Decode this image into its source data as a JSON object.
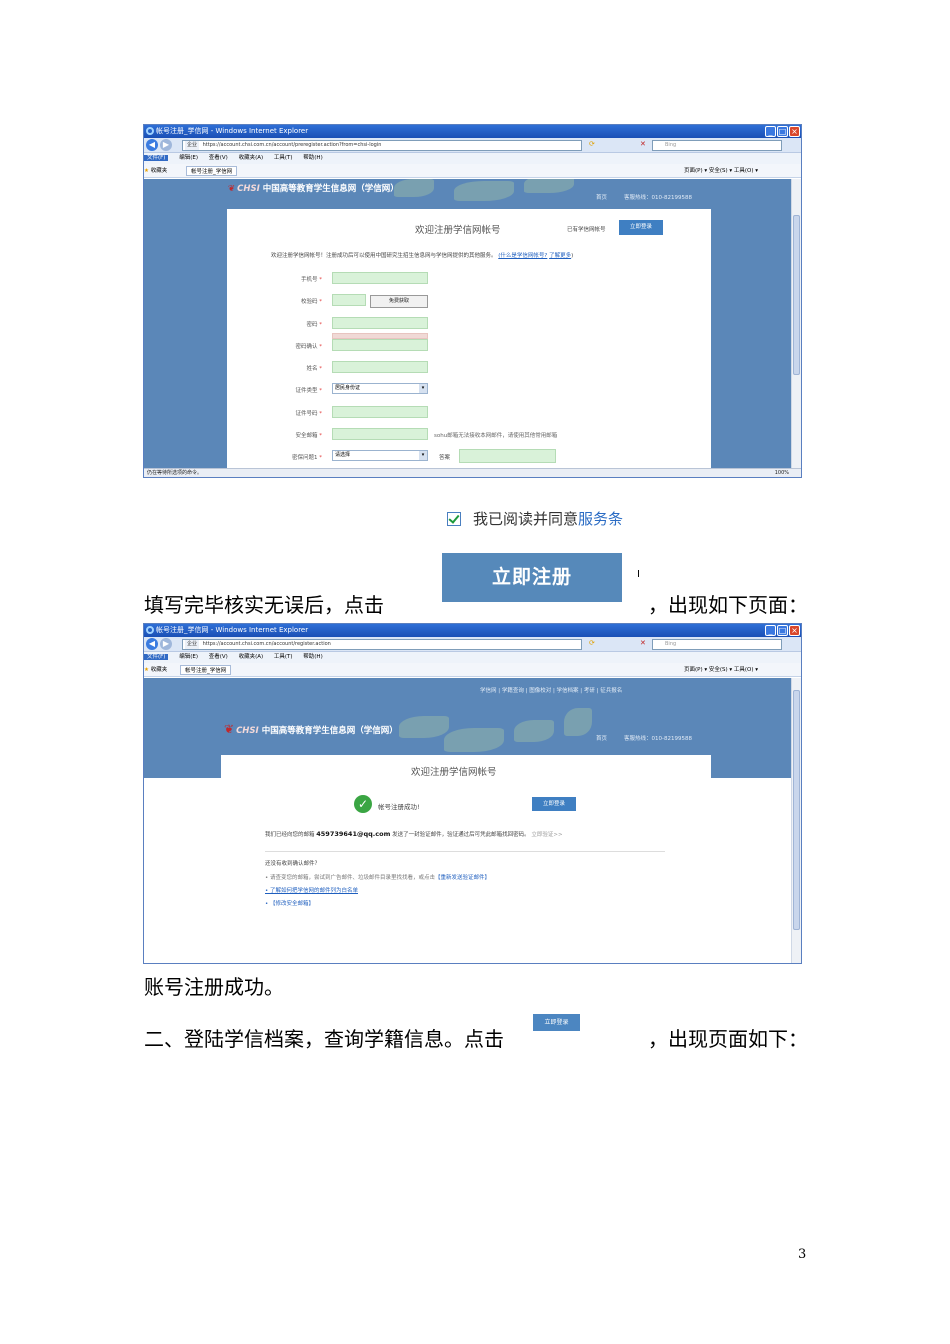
{
  "ie": {
    "title1": "帐号注册_学信网 - Windows Internet Explorer",
    "title2": "帐号注册_学信网 - Windows Internet Explorer",
    "url1": "https://account.chsi.com.cn/account/preregister.action?from=chsi-login",
    "url2": "https://account.chsi.com.cn/account/register.action",
    "secure": "企业",
    "search_placeholder": "Bing",
    "menu": [
      "文件(F)",
      "编辑(E)",
      "查看(V)",
      "收藏夹(A)",
      "工具(T)",
      "帮助(H)"
    ],
    "favorites": "收藏夹",
    "tab": "帐号注册_学信网",
    "tools": "页面(P) ▾   安全(S) ▾   工具(O) ▾",
    "status1": "仍在等待所选项的命令。",
    "zoom": "100%"
  },
  "site": {
    "logo_chsi": "CHSI",
    "logo_name": "中国高等教育学生信息网（学信网）",
    "home": "首页",
    "hotline": "客服热线：010-82199588",
    "topnav": "学信网  |  学籍查询  |  图像校对  |  学信档案  |  考研  |  征兵报名"
  },
  "register": {
    "title": "欢迎注册学信网帐号",
    "have_account": "已有学信网帐号",
    "login_btn": "立即登录",
    "intro": "欢迎注册学信网帐号！注册成功后可以使用中国研究生招生信息网与学信网提供的其他服务。",
    "what_is": "(什么是学信网帐号?",
    "learn_more": "了解更多",
    "learn_close": ")",
    "fields": [
      {
        "label": "手机号",
        "type": "input"
      },
      {
        "label": "校验码",
        "type": "code",
        "button": "免费获取"
      },
      {
        "label": "密码",
        "type": "input"
      },
      {
        "label": "密码确认",
        "type": "input"
      },
      {
        "label": "姓名",
        "type": "input"
      },
      {
        "label": "证件类型",
        "type": "select",
        "value": "居民身份证"
      },
      {
        "label": "证件号码",
        "type": "input"
      },
      {
        "label": "安全邮箱",
        "type": "input",
        "hint": "sohu邮箱无法接收本网邮件，请使用其他常用邮箱"
      },
      {
        "label": "密保问题1",
        "type": "select",
        "value": "请选择",
        "answer_label": "答案"
      }
    ]
  },
  "success": {
    "title": "欢迎注册学信网帐号",
    "message": "帐号注册成功!",
    "login_btn": "立即登录",
    "email_prefix": "我们已经向您的邮箱",
    "email": "459739641@qq.com",
    "email_suffix": "发送了一封验证邮件，验证通过后可凭此邮箱找回密码。",
    "verify_now": "立即验证>>",
    "not_received": "还没有收到确认邮件？",
    "tip1_prefix": "• 请查变您的邮箱，尝试到广告邮件、垃圾邮件目录里找找看，或点击",
    "tip1_link": "【重新发送验证邮件】",
    "tip2": "• 了解如何把学信网的邮件列为白名单",
    "tip3": "• 【修改安全邮箱】"
  },
  "doc": {
    "agree_prefix": "我已阅读并同意",
    "agree_link": "服务条",
    "register_btn": "立即注册",
    "line1_prefix": "填写完毕核实无误后，点击",
    "line1_suffix": "，出现如下页面：",
    "line2": "账号注册成功。",
    "line3_prefix": "二、登陆学信档案，查询学籍信息。点击",
    "line3_suffix": "，出现页面如下：",
    "mini_btn": "立即登录",
    "page_number": "3"
  }
}
